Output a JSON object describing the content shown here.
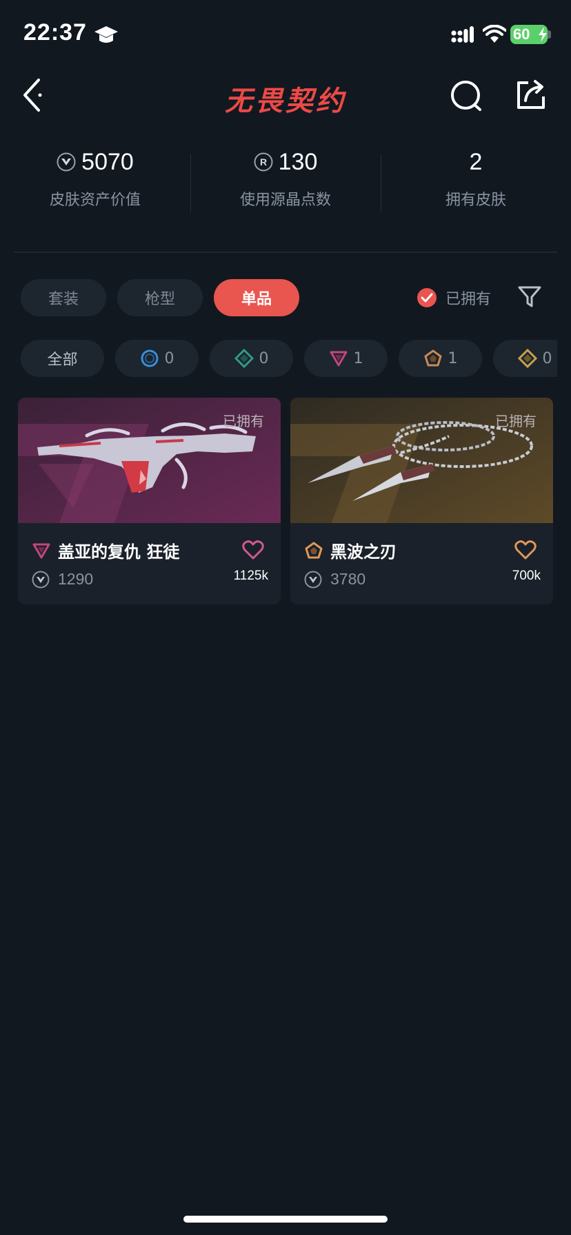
{
  "status_bar": {
    "time": "22:37",
    "battery": "60"
  },
  "nav": {
    "title": "无畏契约"
  },
  "stats": [
    {
      "value": "5070",
      "label": "皮肤资产价值",
      "icon": "valorant-point-icon"
    },
    {
      "value": "130",
      "label": "使用源晶点数",
      "icon": "radianite-icon"
    },
    {
      "value": "2",
      "label": "拥有皮肤",
      "icon": ""
    }
  ],
  "tabs": [
    {
      "label": "套装",
      "active": false
    },
    {
      "label": "枪型",
      "active": false
    },
    {
      "label": "单品",
      "active": true
    }
  ],
  "owned_filter": {
    "label": "已拥有",
    "checked": true
  },
  "rarity_filters": [
    {
      "label": "全部",
      "count": ""
    },
    {
      "tier": "select",
      "count": "0",
      "color": "#3a8fd6"
    },
    {
      "tier": "deluxe",
      "count": "0",
      "color": "#2f9a8a"
    },
    {
      "tier": "premium",
      "count": "1",
      "color": "#c4457f"
    },
    {
      "tier": "exclusive",
      "count": "1",
      "color": "#c98a52"
    },
    {
      "tier": "ultra",
      "count": "0",
      "color": "#c9a24a"
    }
  ],
  "items": [
    {
      "name": "盖亚的复仇 狂徒",
      "price": "1290",
      "likes": "1125k",
      "badge": "已拥有",
      "tier": "premium",
      "tier_color": "#c4457f",
      "heart_color": "#d15a8c"
    },
    {
      "name": "黑波之刃",
      "price": "3780",
      "likes": "700k",
      "badge": "已拥有",
      "tier": "exclusive",
      "tier_color": "#e0985a",
      "heart_color": "#e0985a"
    }
  ],
  "colors": {
    "accent": "#e9554f",
    "background": "#111820",
    "card": "#1a212a"
  }
}
